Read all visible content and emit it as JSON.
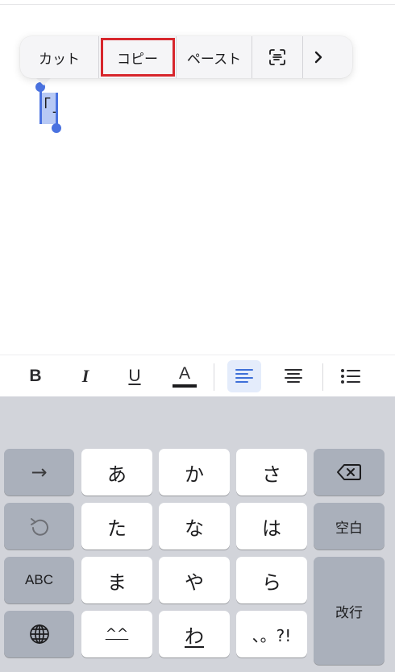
{
  "context_menu": {
    "cut_label": "カット",
    "copy_label": "コピー",
    "paste_label": "ペースト",
    "scan_icon": "scan-text-icon",
    "more_icon": "chevron-right-icon",
    "highlight_color": "#d7262c"
  },
  "document": {
    "selected_text": "「」"
  },
  "format_toolbar": {
    "bold_label": "B",
    "italic_label": "I",
    "underline_label": "U",
    "text_color_label": "A",
    "align_left_icon": "align-left-icon",
    "align_center_icon": "align-center-icon",
    "list_icon": "bullet-list-icon",
    "active_tint": "#e4ecfb"
  },
  "keyboard": {
    "row1": {
      "left": "→",
      "keys": [
        "あ",
        "か",
        "さ"
      ],
      "right_icon": "delete-icon"
    },
    "row2": {
      "left_icon": "undo-icon",
      "keys": [
        "た",
        "な",
        "は"
      ],
      "right": "空白"
    },
    "row3": {
      "left": "ABC",
      "keys": [
        "ま",
        "や",
        "ら"
      ],
      "right": "改行"
    },
    "row4": {
      "left_icon": "globe-icon",
      "keys": [
        "^^",
        "わ",
        "、。?!"
      ]
    }
  },
  "colors": {
    "selection": "#b7c9f5",
    "handle": "#4a72e0",
    "keyboard_bg": "#d2d4da",
    "dark_key": "#aab0bb"
  }
}
